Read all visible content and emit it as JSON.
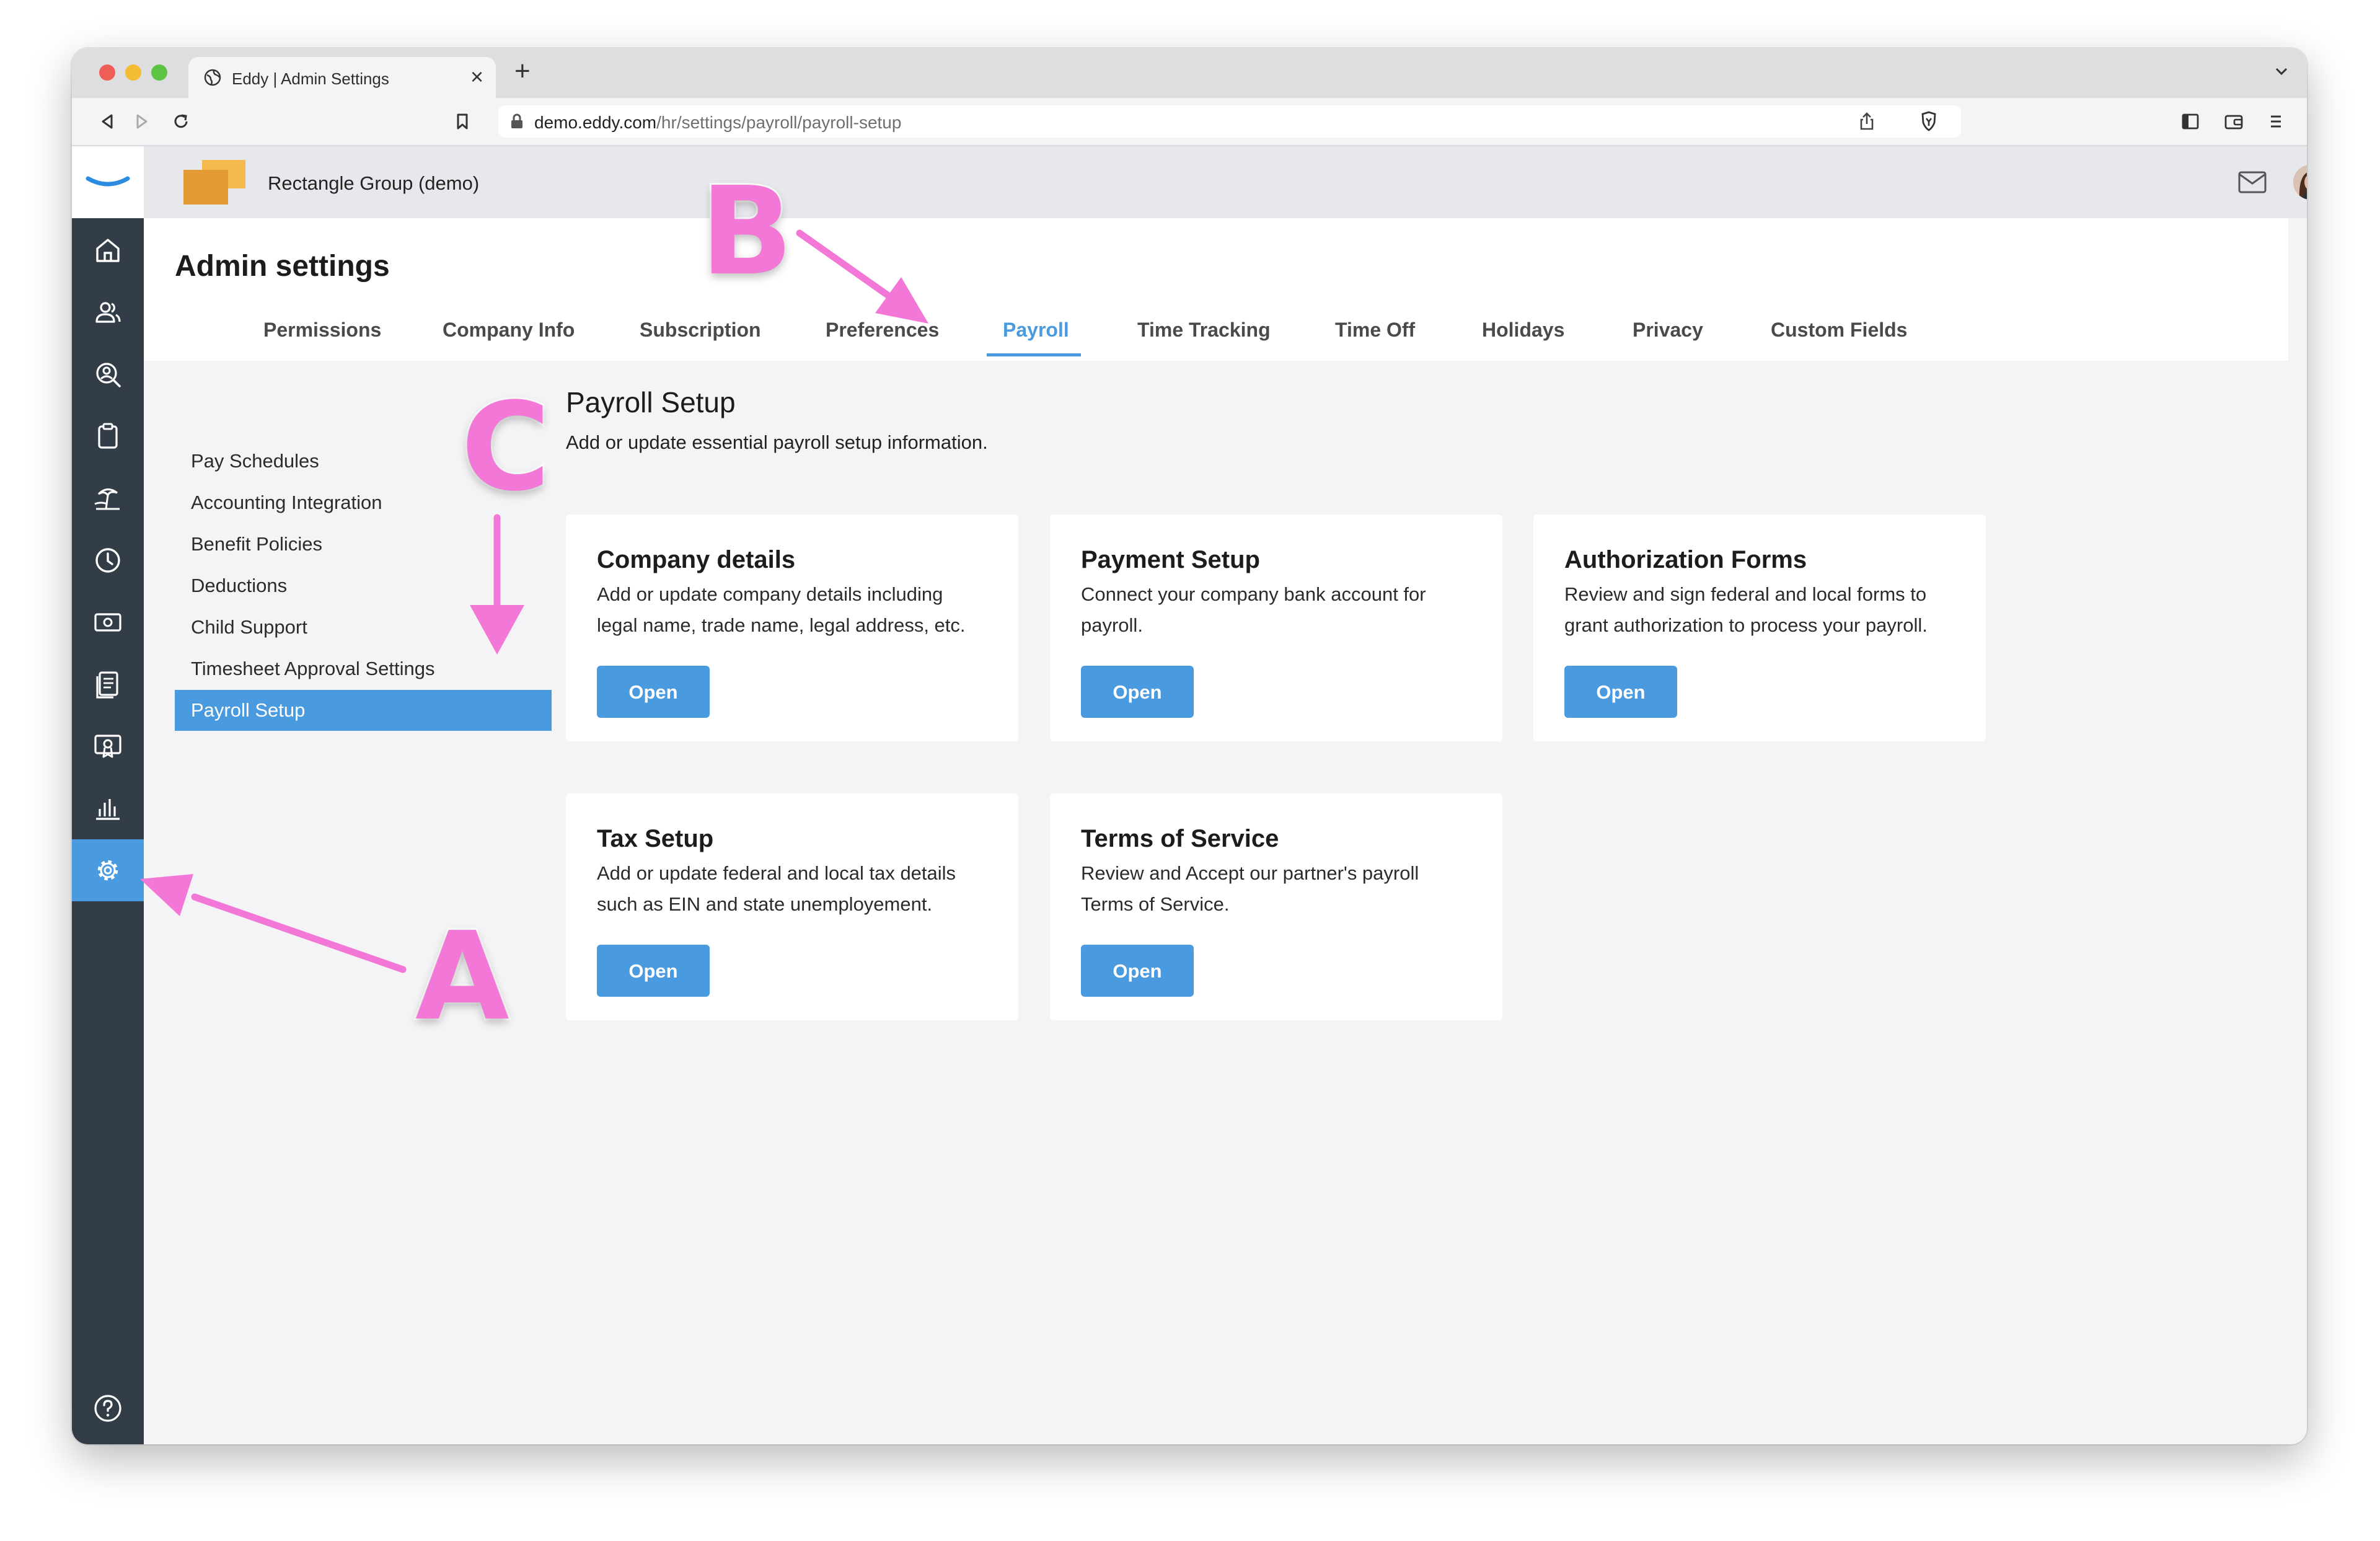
{
  "browser": {
    "tab_title": "Eddy | Admin Settings",
    "tab_close": "×",
    "new_tab": "+",
    "url_host": "demo.eddy.com",
    "url_path": "/hr/settings/payroll/payroll-setup"
  },
  "company": {
    "name": "Rectangle Group (demo)"
  },
  "page": {
    "title": "Admin settings"
  },
  "settings_tabs": [
    {
      "label": "Permissions"
    },
    {
      "label": "Company Info"
    },
    {
      "label": "Subscription"
    },
    {
      "label": "Preferences"
    },
    {
      "label": "Payroll"
    },
    {
      "label": "Time Tracking"
    },
    {
      "label": "Time Off"
    },
    {
      "label": "Holidays"
    },
    {
      "label": "Privacy"
    },
    {
      "label": "Custom Fields"
    }
  ],
  "active_tab": "Payroll",
  "subnav": [
    {
      "label": "Pay Schedules"
    },
    {
      "label": "Accounting Integration"
    },
    {
      "label": "Benefit Policies"
    },
    {
      "label": "Deductions"
    },
    {
      "label": "Child Support"
    },
    {
      "label": "Timesheet Approval Settings"
    },
    {
      "label": "Payroll Setup"
    }
  ],
  "active_subnav": "Payroll Setup",
  "section": {
    "title": "Payroll Setup",
    "description": "Add or update essential payroll setup information."
  },
  "cards": [
    {
      "title": "Company details",
      "desc_line1": "Add or update company details including",
      "desc_line2": "legal name, trade name, legal address, etc.",
      "button": "Open"
    },
    {
      "title": "Payment Setup",
      "desc_line1": "Connect your company bank account for",
      "desc_line2": "payroll.",
      "button": "Open"
    },
    {
      "title": "Authorization Forms",
      "desc_line1": "Review and sign federal and local forms to",
      "desc_line2": "grant authorization to process your payroll.",
      "button": "Open"
    },
    {
      "title": "Tax Setup",
      "desc_line1": "Add or update federal and local tax details",
      "desc_line2": "such as EIN and state unemployement.",
      "button": "Open"
    },
    {
      "title": "Terms of Service",
      "desc_line1": "Review and Accept our partner's payroll",
      "desc_line2": "Terms of Service.",
      "button": "Open"
    }
  ],
  "sidebar_icons": [
    "home-icon",
    "people-icon",
    "user-search-icon",
    "clipboard-icon",
    "beach-icon",
    "clock-icon",
    "money-icon",
    "documents-icon",
    "certificate-icon",
    "bar-chart-icon",
    "gear-icon",
    "help-icon"
  ],
  "annotations": {
    "a": "A",
    "b": "B",
    "c": "C"
  },
  "colors": {
    "accent": "#4a9ae0",
    "sidebar": "#333d47",
    "annotation": "#f377d6"
  }
}
